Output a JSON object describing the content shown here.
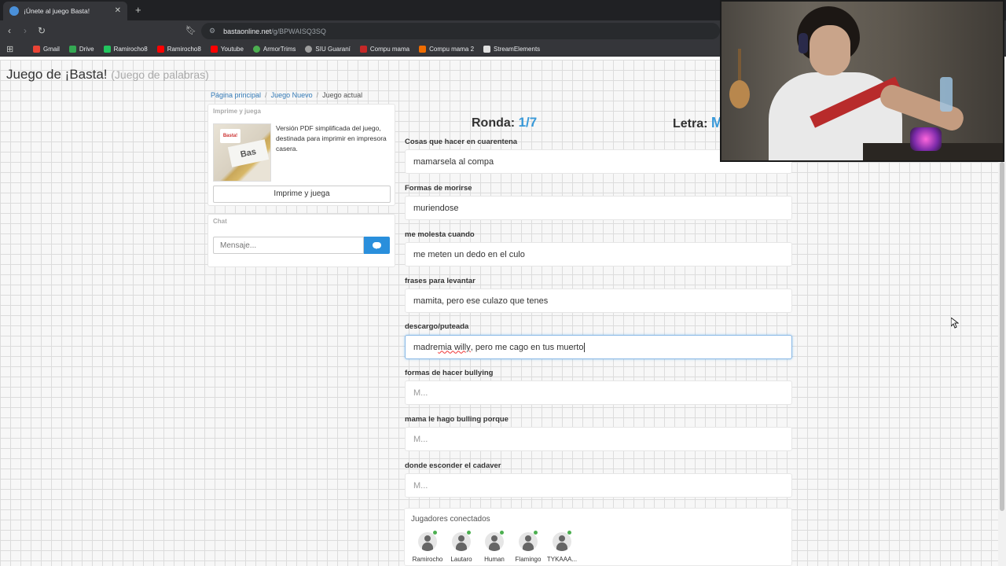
{
  "browser": {
    "tab_title": "¡Únete al juego Basta!",
    "new_tab": "+",
    "url_host": "bastaonline.net",
    "url_path": "/g/BPWAISQ3SQ",
    "bookmarks": [
      {
        "label": "Gmail",
        "color": "#ea4335"
      },
      {
        "label": "Drive",
        "color": "#34a853"
      },
      {
        "label": "Ramirocho8",
        "color": "#22c55e"
      },
      {
        "label": "Ramirocho8",
        "color": "#ff0000"
      },
      {
        "label": "Youtube",
        "color": "#ff0000"
      },
      {
        "label": "ArmorTrims",
        "color": "#4caf50"
      },
      {
        "label": "SIU Guaraní",
        "color": "#9e9e9e"
      },
      {
        "label": "Compu mama",
        "color": "#c62828"
      },
      {
        "label": "Compu mama 2",
        "color": "#ef6c00"
      },
      {
        "label": "StreamElements",
        "color": "#e0e0e0"
      }
    ]
  },
  "site": {
    "title": "Juego de ¡Basta!",
    "subtitle": "(Juego de palabras)"
  },
  "breadcrumb": {
    "home": "Página principal",
    "new_game": "Juego Nuevo",
    "current": "Juego actual",
    "separator": "/"
  },
  "print_panel": {
    "heading": "Imprime y juega",
    "description": "Versión PDF simplificada del juego, destinada para imprimir en impresora casera.",
    "button": "Imprime y juega"
  },
  "chat": {
    "heading": "Chat",
    "placeholder": "Mensaje..."
  },
  "game": {
    "round_label": "Ronda:",
    "round_value": "1/7",
    "letter_label": "Letra:",
    "letter_value": "M",
    "categories": [
      {
        "label": "Cosas que hacer en cuarentena",
        "value": "mamarsela al compa"
      },
      {
        "label": "Formas de morirse",
        "value": "muriendose"
      },
      {
        "label": "me molesta cuando",
        "value": "me meten un dedo en el culo"
      },
      {
        "label": "frases para levantar",
        "value": "mamita, pero ese culazo que tenes"
      },
      {
        "label": "descargo/puteada",
        "value_a": "madre ",
        "value_b": "mia willy",
        "value_c": ", pero me cago en tus muerto"
      },
      {
        "label": "formas de hacer bullying",
        "placeholder": "M..."
      },
      {
        "label": "mama le hago bulling porque",
        "placeholder": "M..."
      },
      {
        "label": "donde esconder el cadaver",
        "placeholder": "M..."
      }
    ]
  },
  "players": {
    "title": "Jugadores conectados",
    "list": [
      {
        "name": "Ramirocho"
      },
      {
        "name": "Lautaro"
      },
      {
        "name": "Human"
      },
      {
        "name": "Flamingo"
      },
      {
        "name": "TYKAAA..."
      }
    ]
  },
  "colors": {
    "accent": "#3a9ad9",
    "chat_button": "#2a8fdc",
    "online_dot": "#4caf50"
  }
}
